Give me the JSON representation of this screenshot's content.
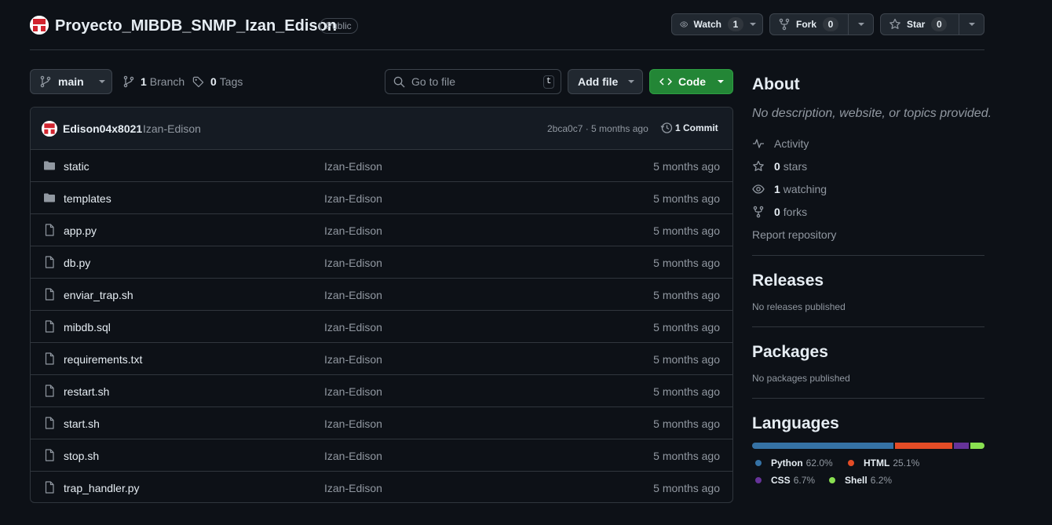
{
  "repo": {
    "name": "Proyecto_MIBDB_SNMP_Izan_Edison",
    "visibility": "Public",
    "watch_label": "Watch",
    "watch_count": "1",
    "fork_label": "Fork",
    "fork_count": "0",
    "star_label": "Star",
    "star_count": "0"
  },
  "toolbar": {
    "branch": "main",
    "branch_count": "1",
    "branch_label": "Branch",
    "tag_count": "0",
    "tag_label": "Tags",
    "search_placeholder": "Go to file",
    "search_shortcut": "t",
    "add_file_label": "Add file",
    "code_label": "Code"
  },
  "commit": {
    "user": "Edison04x8021",
    "message": "Izan-Edison",
    "sha_time": "2bca0c7 · 5 months ago",
    "count_label": "1 Commit"
  },
  "files": [
    {
      "name": "static",
      "type": "folder",
      "message": "Izan-Edison",
      "date": "5 months ago"
    },
    {
      "name": "templates",
      "type": "folder",
      "message": "Izan-Edison",
      "date": "5 months ago"
    },
    {
      "name": "app.py",
      "type": "file",
      "message": "Izan-Edison",
      "date": "5 months ago"
    },
    {
      "name": "db.py",
      "type": "file",
      "message": "Izan-Edison",
      "date": "5 months ago"
    },
    {
      "name": "enviar_trap.sh",
      "type": "file",
      "message": "Izan-Edison",
      "date": "5 months ago"
    },
    {
      "name": "mibdb.sql",
      "type": "file",
      "message": "Izan-Edison",
      "date": "5 months ago"
    },
    {
      "name": "requirements.txt",
      "type": "file",
      "message": "Izan-Edison",
      "date": "5 months ago"
    },
    {
      "name": "restart.sh",
      "type": "file",
      "message": "Izan-Edison",
      "date": "5 months ago"
    },
    {
      "name": "start.sh",
      "type": "file",
      "message": "Izan-Edison",
      "date": "5 months ago"
    },
    {
      "name": "stop.sh",
      "type": "file",
      "message": "Izan-Edison",
      "date": "5 months ago"
    },
    {
      "name": "trap_handler.py",
      "type": "file",
      "message": "Izan-Edison",
      "date": "5 months ago"
    }
  ],
  "about": {
    "title": "About",
    "description": "No description, website, or topics provided.",
    "activity": "Activity",
    "stars_count": "0",
    "stars_label": "stars",
    "watching_count": "1",
    "watching_label": "watching",
    "forks_count": "0",
    "forks_label": "forks",
    "report": "Report repository"
  },
  "releases": {
    "title": "Releases",
    "text": "No releases published"
  },
  "packages": {
    "title": "Packages",
    "text": "No packages published"
  },
  "languages": {
    "title": "Languages",
    "items": [
      {
        "name": "Python",
        "percent": "62.0%",
        "value": 62.0,
        "color": "#3572A5"
      },
      {
        "name": "HTML",
        "percent": "25.1%",
        "value": 25.1,
        "color": "#e34c26"
      },
      {
        "name": "CSS",
        "percent": "6.7%",
        "value": 6.7,
        "color": "#663399"
      },
      {
        "name": "Shell",
        "percent": "6.2%",
        "value": 6.2,
        "color": "#89e051"
      }
    ]
  }
}
